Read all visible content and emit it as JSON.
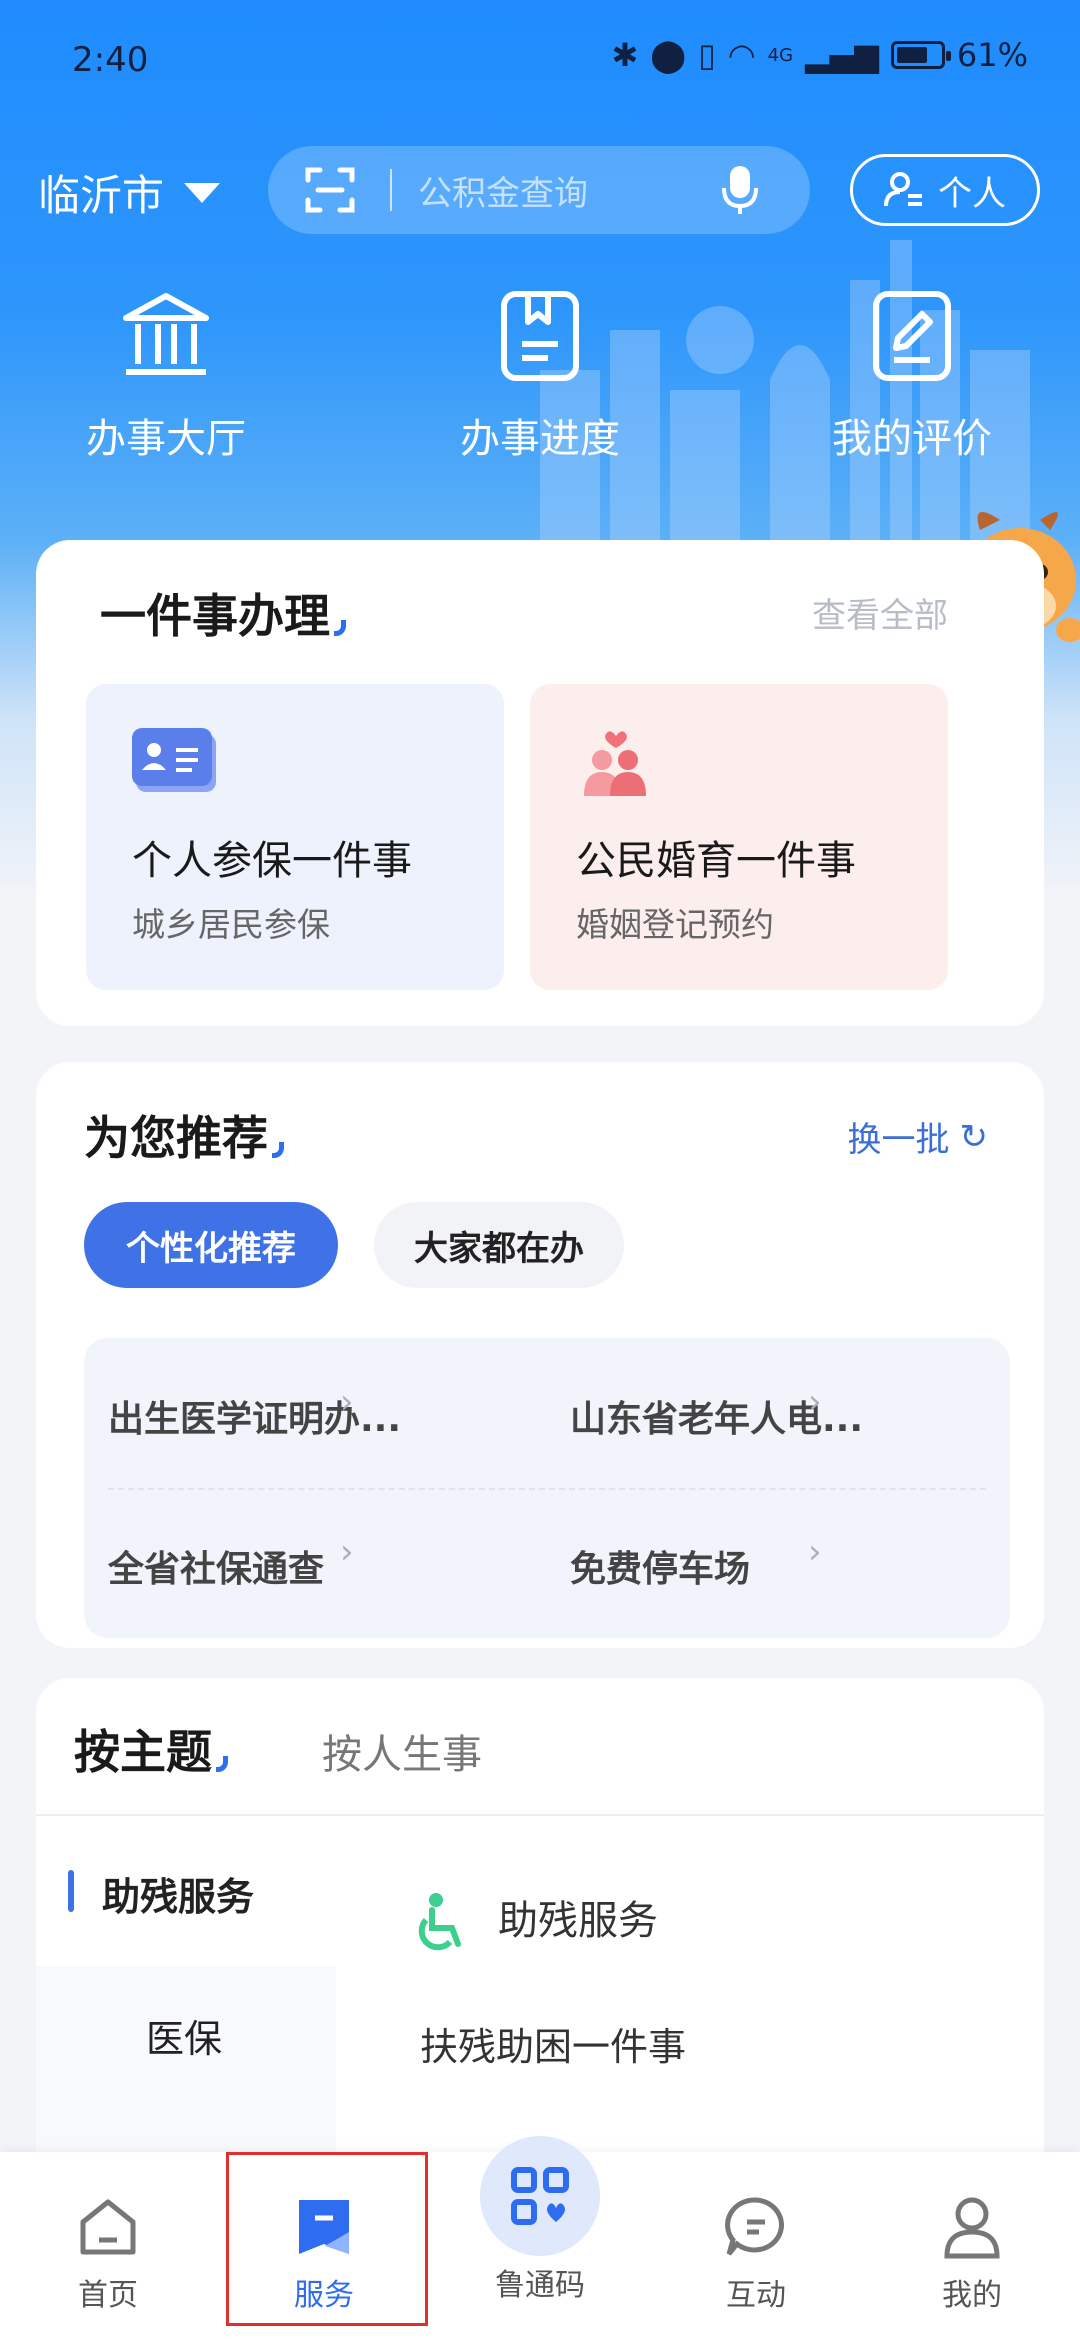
{
  "status_bar": {
    "time": "2:40",
    "battery": "61%",
    "network": "4G"
  },
  "header": {
    "city": "临沂市",
    "search_placeholder": "公积金查询",
    "personal_label": "个人"
  },
  "quick_actions": [
    {
      "label": "办事大厅",
      "icon": "building-icon"
    },
    {
      "label": "办事进度",
      "icon": "bookmark-doc-icon"
    },
    {
      "label": "我的评价",
      "icon": "edit-doc-icon"
    }
  ],
  "one_thing": {
    "title": "一件事办理",
    "view_all": "查看全部",
    "cards": [
      {
        "title": "个人参保一件事",
        "subtitle": "城乡居民参保",
        "icon": "id-card-icon",
        "bg": "#eef2fd"
      },
      {
        "title": "公民婚育一件事",
        "subtitle": "婚姻登记预约",
        "icon": "couple-icon",
        "bg": "#fdeeee"
      }
    ]
  },
  "recommend": {
    "title": "为您推荐",
    "refresh_label": "换一批",
    "chips": [
      "个性化推荐",
      "大家都在办"
    ],
    "items": [
      "出生医学证明办...",
      "山东省老年人电...",
      "全省社保通查",
      "免费停车场"
    ]
  },
  "theme": {
    "tab_active": "按主题",
    "tab_other": "按人生事",
    "side_items": [
      "助残服务",
      "医保"
    ],
    "content_heading": "助残服务",
    "content_items": [
      "扶残助困一件事"
    ]
  },
  "bottom_nav": {
    "items": [
      "首页",
      "服务",
      "鲁通码",
      "互动",
      "我的"
    ],
    "active": "服务"
  },
  "colors": {
    "accent": "#2f6df0",
    "hero": "#1f8cff",
    "highlight_box": "#e0302e"
  }
}
